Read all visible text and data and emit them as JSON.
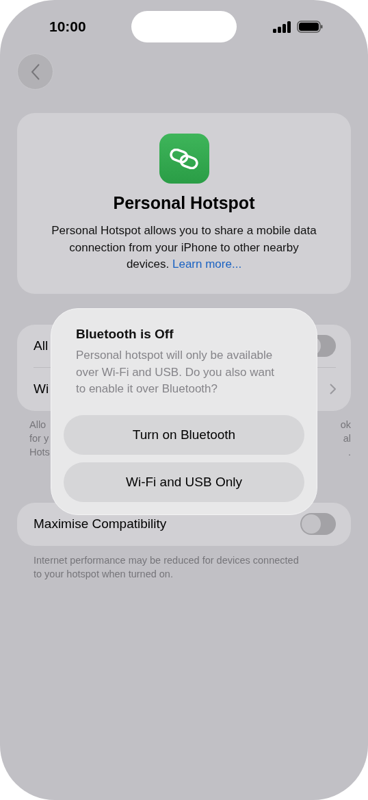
{
  "status_bar": {
    "time": "10:00"
  },
  "header": {
    "title": "Personal Hotspot",
    "description": "Personal Hotspot allows you to share a mobile data connection from your iPhone to other nearby devices.",
    "link": "Learn more..."
  },
  "settings": [
    {
      "kind": "toggle",
      "label": "All",
      "on": false
    },
    {
      "kind": "link",
      "label": "Wi"
    }
  ],
  "settings_footer": {
    "left": [
      "Allo",
      "for y",
      "Hots"
    ],
    "right": [
      "ok",
      "al",
      "."
    ]
  },
  "compatibility": {
    "label": "Maximise Compatibility",
    "on": false,
    "footer": "Internet performance may be reduced for devices connected to your hotspot when turned on."
  },
  "dialog": {
    "title": "Bluetooth is Off",
    "message": "Personal hotspot will only be available over Wi-Fi and USB. Do you also want to enable it over Bluetooth?",
    "buttons": [
      "Turn on Bluetooth",
      "Wi-Fi and USB Only"
    ]
  }
}
